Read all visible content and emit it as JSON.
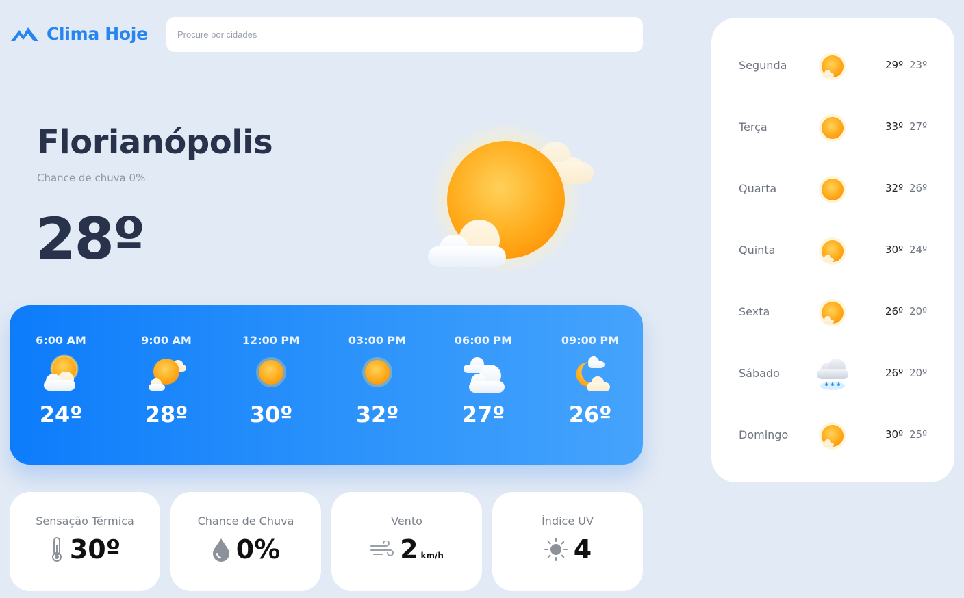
{
  "app": {
    "name": "Clima Hoje"
  },
  "search": {
    "placeholder": "Procure por cidades"
  },
  "current": {
    "city": "Florianópolis",
    "rain_chance_text": "Chance de chuva 0%",
    "temperature": "28º",
    "icon": "sun-cloud-icon"
  },
  "hourly": [
    {
      "time": "6:00 AM",
      "temp": "24º",
      "icon": "partly-cloudy-icon"
    },
    {
      "time": "9:00 AM",
      "temp": "28º",
      "icon": "sun-cloud-icon"
    },
    {
      "time": "12:00 PM",
      "temp": "30º",
      "icon": "sun-icon"
    },
    {
      "time": "03:00 PM",
      "temp": "32º",
      "icon": "sun-icon"
    },
    {
      "time": "06:00 PM",
      "temp": "27º",
      "icon": "cloudy-icon"
    },
    {
      "time": "09:00 PM",
      "temp": "26º",
      "icon": "moon-cloud-icon"
    }
  ],
  "cards": {
    "feels_like": {
      "title": "Sensação Térmica",
      "value": "30º",
      "icon": "thermometer-icon"
    },
    "rain": {
      "title": "Chance de Chuva",
      "value": "0%",
      "icon": "drop-icon"
    },
    "wind": {
      "title": "Vento",
      "value": "2",
      "unit": "km/h",
      "icon": "wind-icon"
    },
    "uv": {
      "title": "Índice UV",
      "value": "4",
      "icon": "uv-sun-icon"
    }
  },
  "week": [
    {
      "day": "Segunda",
      "max": "29º",
      "min": "23º",
      "icon": "sun-small-cloud-icon"
    },
    {
      "day": "Terça",
      "max": "33º",
      "min": "27º",
      "icon": "sun-icon"
    },
    {
      "day": "Quarta",
      "max": "32º",
      "min": "26º",
      "icon": "sun-icon"
    },
    {
      "day": "Quinta",
      "max": "30º",
      "min": "24º",
      "icon": "sun-small-cloud-icon"
    },
    {
      "day": "Sexta",
      "max": "26º",
      "min": "20º",
      "icon": "sun-small-cloud-icon"
    },
    {
      "day": "Sábado",
      "max": "26º",
      "min": "20º",
      "icon": "rain-cloud-icon"
    },
    {
      "day": "Domingo",
      "max": "30º",
      "min": "25º",
      "icon": "sun-small-cloud-icon"
    }
  ],
  "colors": {
    "background": "#e2eaf5",
    "brand": "#2785f2",
    "panel_gradient_start": "#0d7cfb",
    "panel_gradient_end": "#45a3fc",
    "sun": "#ffa31a",
    "text_dark": "#28324b"
  }
}
